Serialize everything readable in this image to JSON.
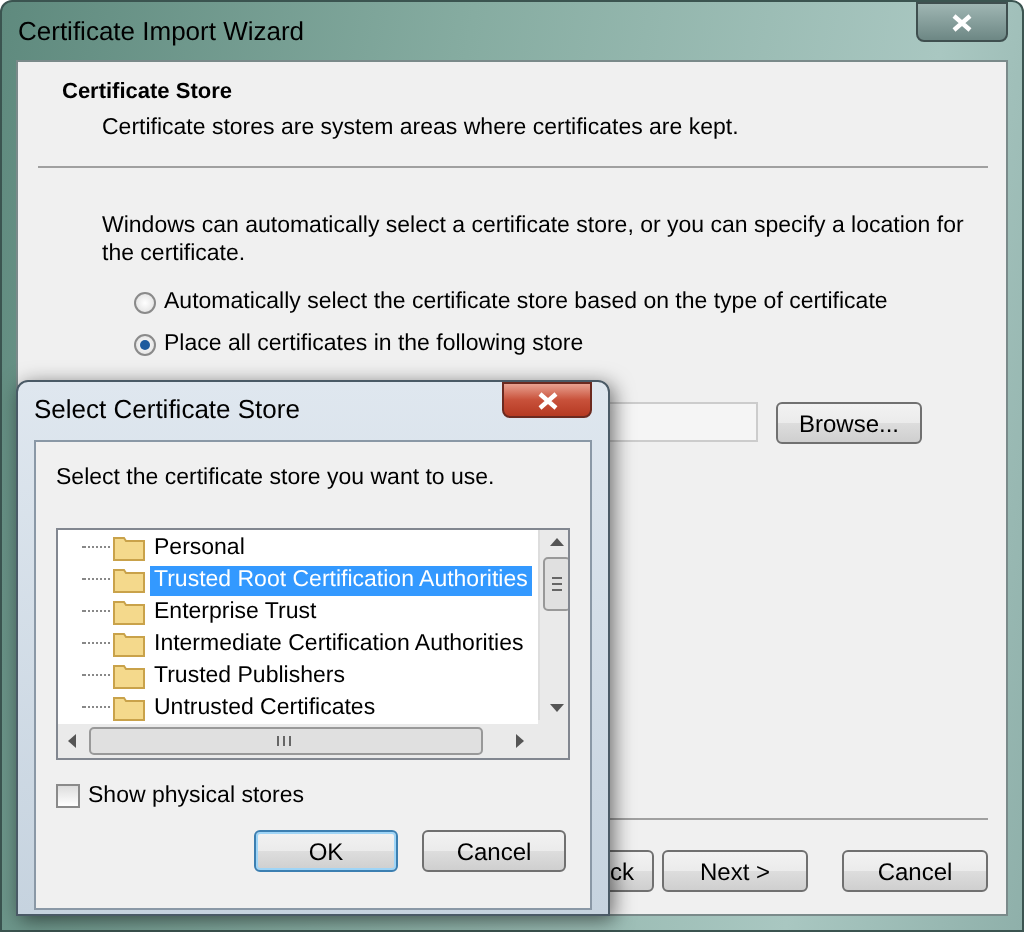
{
  "wizard": {
    "title": "Certificate Import Wizard",
    "heading": "Certificate Store",
    "subheading": "Certificate stores are system areas where certificates are kept.",
    "intro": "Windows can automatically select a certificate store, or you can specify a location for the certificate.",
    "options": [
      {
        "label": "Automatically select the certificate store based on the type of certificate",
        "selected": false
      },
      {
        "label": "Place all certificates in the following store",
        "selected": true
      }
    ],
    "browse_button": "Browse...",
    "buttons": [
      {
        "label": "ck",
        "kind": "back"
      },
      {
        "label": "Next >",
        "kind": "next"
      },
      {
        "label": "Cancel",
        "kind": "cancel"
      }
    ]
  },
  "dialog": {
    "title": "Select Certificate Store",
    "prompt": "Select the certificate store you want to use.",
    "stores": [
      {
        "label": "Personal",
        "selected": false
      },
      {
        "label": "Trusted Root Certification Authorities",
        "selected": true
      },
      {
        "label": "Enterprise Trust",
        "selected": false
      },
      {
        "label": "Intermediate Certification Authorities",
        "selected": false
      },
      {
        "label": "Trusted Publishers",
        "selected": false
      },
      {
        "label": "Untrusted Certificates",
        "selected": false
      }
    ],
    "show_physical": {
      "label": "Show physical stores",
      "checked": false
    },
    "buttons": [
      {
        "label": "OK",
        "kind": "default"
      },
      {
        "label": "Cancel",
        "kind": "normal"
      }
    ]
  }
}
